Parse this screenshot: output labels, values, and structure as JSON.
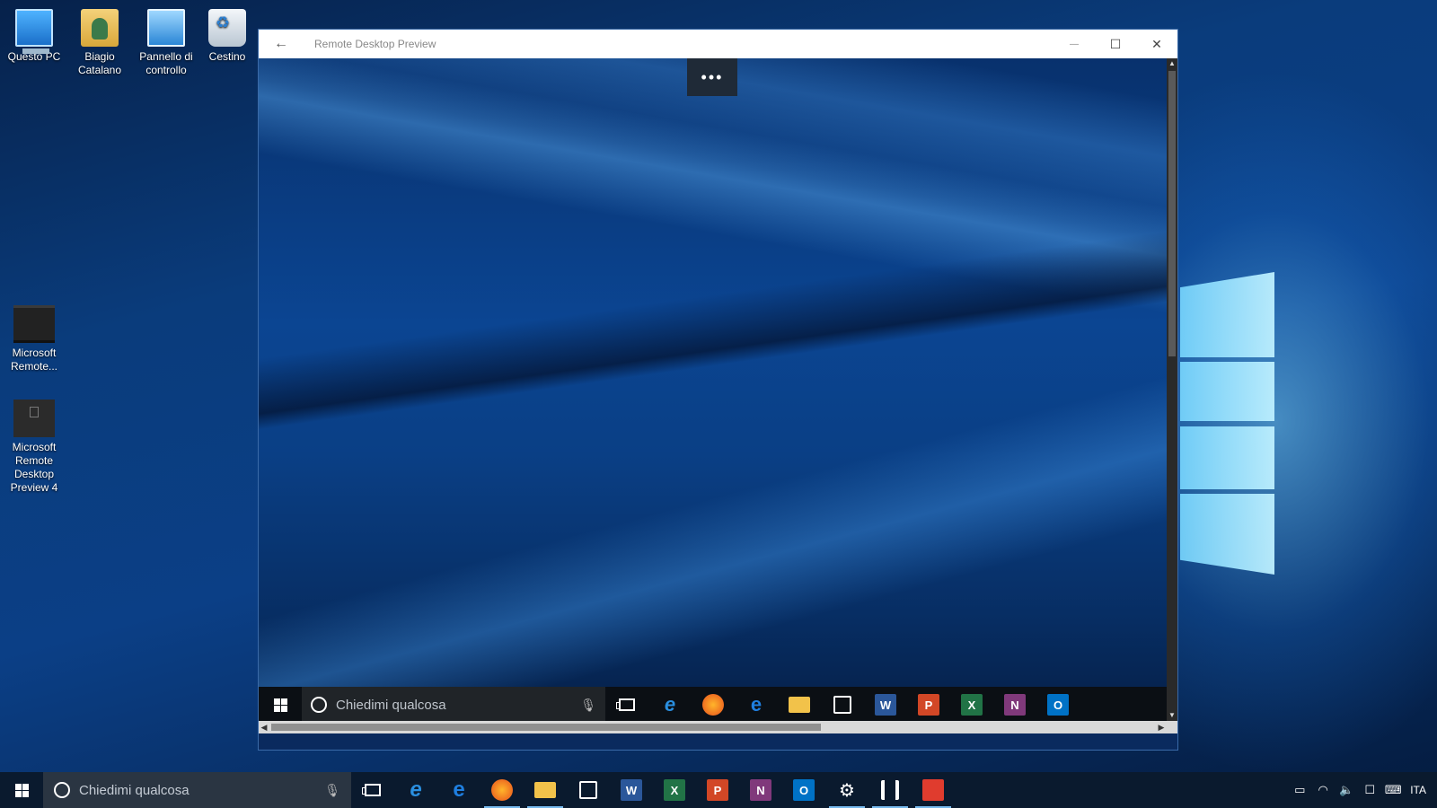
{
  "desktop": {
    "icons": [
      {
        "label": "Questo PC",
        "icon": "computer-icon"
      },
      {
        "label": "Biagio\nCatalano",
        "icon": "user-folder-icon"
      },
      {
        "label": "Pannello di\ncontrollo",
        "icon": "control-panel-icon"
      },
      {
        "label": "Cestino",
        "icon": "recycle-bin-icon"
      },
      {
        "label": "Microsoft\nRemote...",
        "icon": "remote-desktop-icon"
      },
      {
        "label": "Microsoft\nRemote\nDesktop\nPreview 4",
        "icon": "remote-desktop-preview-icon"
      }
    ]
  },
  "window": {
    "title": "Remote Desktop Preview",
    "back": "←",
    "minimize": "—",
    "maximize": "☐",
    "close": "✕",
    "more_button": "•••",
    "remote_taskbar": {
      "search_placeholder": "Chiedimi qualcosa",
      "apps": [
        "task-view",
        "internet-explorer",
        "firefox",
        "edge",
        "file-explorer",
        "store",
        "word",
        "powerpoint",
        "excel",
        "onenote",
        "outlook"
      ]
    }
  },
  "taskbar": {
    "search_placeholder": "Chiedimi qualcosa",
    "apps": [
      {
        "name": "task-view"
      },
      {
        "name": "internet-explorer",
        "label": "e",
        "color": "#2a8fe0"
      },
      {
        "name": "edge",
        "label": "e",
        "color": "#1f7fe0"
      },
      {
        "name": "firefox",
        "label": "",
        "color": "#e86a1d",
        "active": true
      },
      {
        "name": "file-explorer",
        "label": "",
        "color": "#f2c24a",
        "active": true
      },
      {
        "name": "store",
        "label": "",
        "color": "#ffffff"
      },
      {
        "name": "word",
        "label": "W",
        "color": "#2b579a"
      },
      {
        "name": "excel",
        "label": "X",
        "color": "#217346"
      },
      {
        "name": "powerpoint",
        "label": "P",
        "color": "#d24726"
      },
      {
        "name": "onenote",
        "label": "N",
        "color": "#80397b"
      },
      {
        "name": "outlook",
        "label": "O",
        "color": "#0072c6"
      },
      {
        "name": "settings",
        "label": "⚙",
        "color": "#ffffff",
        "active": true
      },
      {
        "name": "network-app",
        "label": "",
        "color": "#ffffff",
        "active": true
      },
      {
        "name": "remote-desktop",
        "label": "",
        "color": "#e03c2e",
        "active": true
      }
    ],
    "tray": {
      "language": "ITA"
    }
  },
  "colors": {
    "accent": "#76b9ed",
    "taskbar_bg": "#0a1a2e"
  }
}
